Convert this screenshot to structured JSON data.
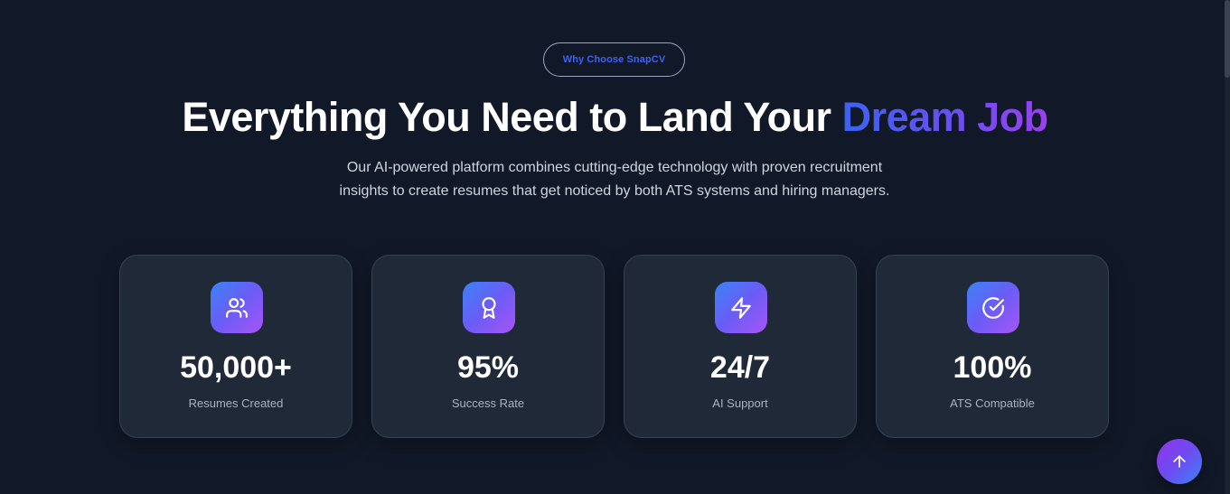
{
  "section": {
    "badge_label": "Why Choose SnapCV",
    "headline": {
      "main": "Everything You Need to Land Your",
      "highlight": "Dream Job"
    },
    "subtitle": {
      "line1": "Our AI-powered platform combines cutting-edge technology with proven recruitment",
      "line2": "insights to create resumes that get noticed by both ATS systems and hiring managers."
    }
  },
  "stats": [
    {
      "icon": "users-icon",
      "value": "50,000+",
      "label": "Resumes Created"
    },
    {
      "icon": "award-icon",
      "value": "95%",
      "label": "Success Rate"
    },
    {
      "icon": "lightning-icon",
      "value": "24/7",
      "label": "AI Support"
    },
    {
      "icon": "check-circle-icon",
      "value": "100%",
      "label": "ATS Compatible"
    }
  ],
  "scroll_top": {
    "icon": "arrow-up-icon"
  },
  "colors": {
    "background": "#111827",
    "card_background": "#1f2937",
    "accent_blue": "#3b63f0",
    "accent_purple": "#9b3ff0"
  }
}
